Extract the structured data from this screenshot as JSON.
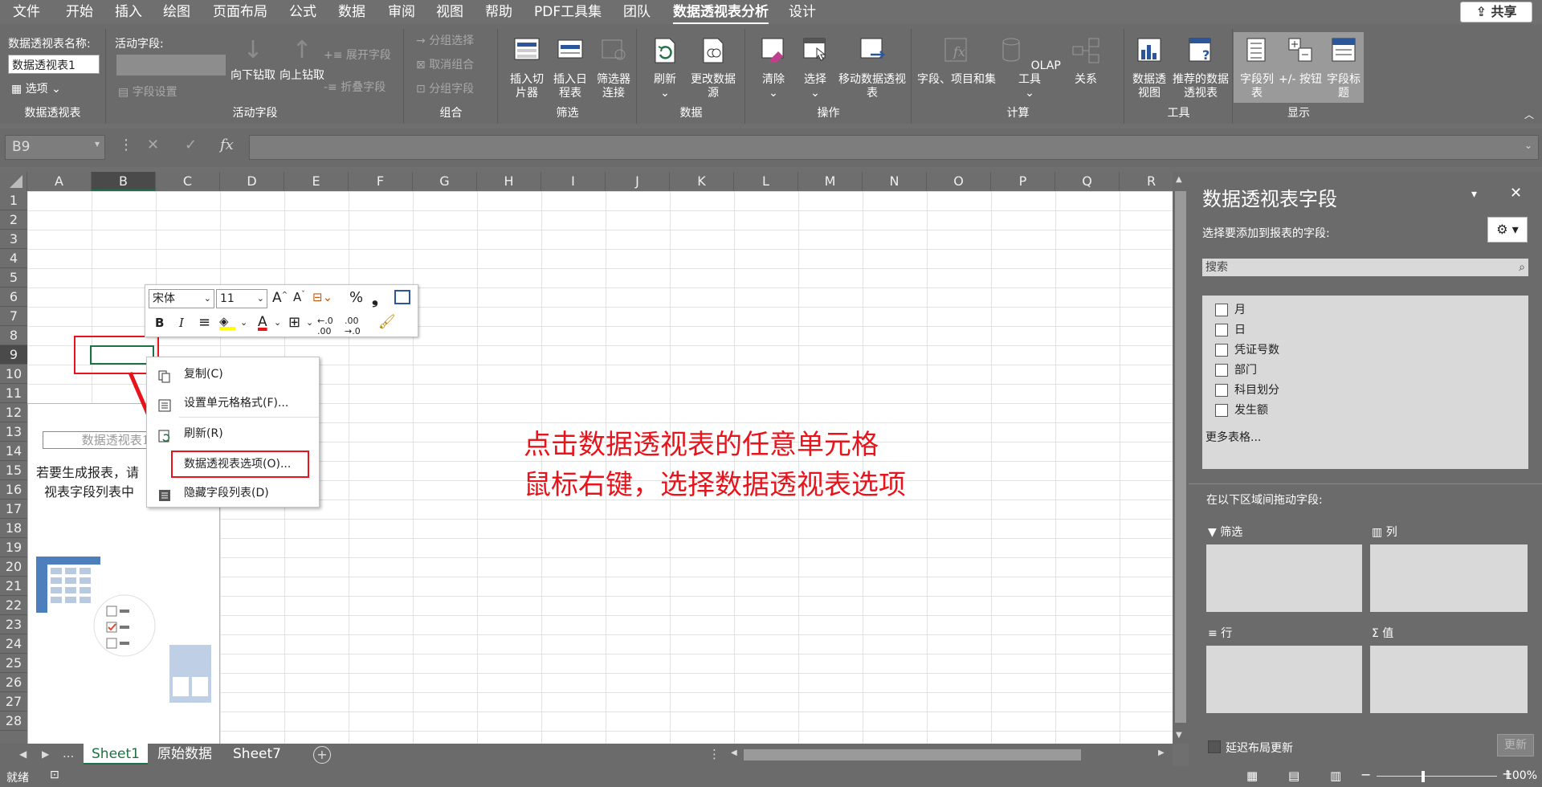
{
  "tabs": [
    "文件",
    "开始",
    "插入",
    "绘图",
    "页面布局",
    "公式",
    "数据",
    "审阅",
    "视图",
    "帮助",
    "PDF工具集",
    "团队",
    "数据透视表分析",
    "设计"
  ],
  "active_tab": "数据透视表分析",
  "share_label": "共享",
  "ribbon": {
    "pivot_group": {
      "name_label": "数据透视表名称:",
      "name_value": "数据透视表1",
      "options_label": "选项",
      "group_label": "数据透视表"
    },
    "active_field": {
      "label": "活动字段:",
      "field_settings": "字段设置",
      "drill_down": "向下钻取",
      "drill_up": "向上钻取",
      "expand": "展开字段",
      "collapse": "折叠字段",
      "group_label": "活动字段"
    },
    "group": {
      "group_selection": "分组选择",
      "ungroup": "取消组合",
      "group_field": "分组字段",
      "group_label": "组合"
    },
    "filter": {
      "insert_slicer": "插入切片器",
      "insert_timeline": "插入日程表",
      "filter_connections": "筛选器连接",
      "group_label": "筛选"
    },
    "data": {
      "refresh": "刷新",
      "change_source": "更改数据源",
      "group_label": "数据"
    },
    "actions": {
      "clear": "清除",
      "select": "选择",
      "move": "移动数据透视表",
      "group_label": "操作"
    },
    "calc": {
      "fields_items": "字段、项目和集",
      "olap": "OLAP 工具",
      "relations": "关系",
      "group_label": "计算"
    },
    "tools": {
      "pivot_chart": "数据透视图",
      "recommended": "推荐的数据透视表",
      "group_label": "工具"
    },
    "show": {
      "field_list": "字段列表",
      "buttons": "+/- 按钮",
      "headers": "字段标题",
      "group_label": "显示"
    }
  },
  "namebox": "B9",
  "formula_icons": {
    "cancel": "✕",
    "enter": "✓",
    "fx": "fx"
  },
  "columns": [
    "A",
    "B",
    "C",
    "D",
    "E",
    "F",
    "G",
    "H",
    "I",
    "J",
    "K",
    "L",
    "M",
    "N",
    "O",
    "P",
    "Q",
    "R"
  ],
  "selected_col": "B",
  "rows": [
    "1",
    "2",
    "3",
    "4",
    "5",
    "6",
    "7",
    "8",
    "9",
    "10",
    "11",
    "12",
    "13",
    "14",
    "15",
    "16",
    "17",
    "18",
    "19",
    "20",
    "21",
    "22",
    "23",
    "24",
    "25",
    "26",
    "27",
    "28"
  ],
  "selected_row": "9",
  "pivot_placeholder": {
    "title": "数据透视表1",
    "line1": "若要生成报表，请",
    "line2": "视表字段列表中"
  },
  "annotation": {
    "line1": "点击数据透视表的任意单元格",
    "line2": "鼠标右键，选择数据透视表选项"
  },
  "mini_toolbar": {
    "font": "宋体",
    "size": "11"
  },
  "context_menu": {
    "copy": "复制(C)",
    "format_cells": "设置单元格格式(F)...",
    "refresh": "刷新(R)",
    "pivot_options": "数据透视表选项(O)...",
    "hide_field_list": "隐藏字段列表(D)"
  },
  "pane": {
    "title": "数据透视表字段",
    "subtitle": "选择要添加到报表的字段:",
    "search_placeholder": "搜索",
    "fields": [
      "月",
      "日",
      "凭证号数",
      "部门",
      "科目划分",
      "发生额"
    ],
    "more_tables": "更多表格...",
    "drag_label": "在以下区域间拖动字段:",
    "areas": {
      "filters": "筛选",
      "columns": "列",
      "rows": "行",
      "values": "值"
    },
    "defer_label": "延迟布局更新",
    "update_button": "更新"
  },
  "sheets": [
    "Sheet1",
    "原始数据",
    "Sheet7"
  ],
  "active_sheet": "Sheet1",
  "sheet_nav": {
    "ellipsis": "..."
  },
  "status": {
    "ready": "就绪",
    "zoom": "100%"
  }
}
